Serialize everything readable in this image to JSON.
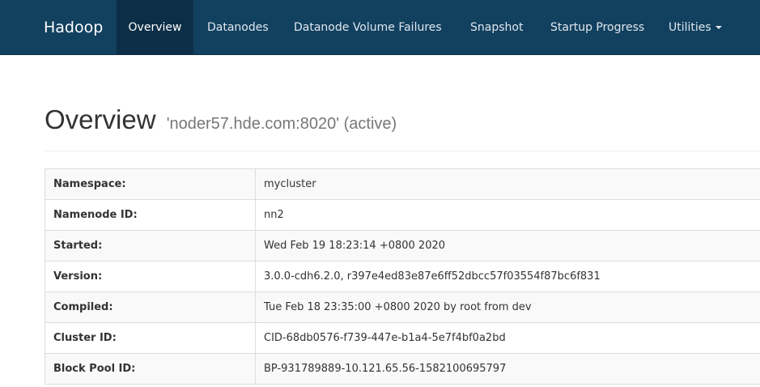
{
  "navbar": {
    "brand": "Hadoop",
    "items": [
      {
        "label": "Overview"
      },
      {
        "label": "Datanodes"
      },
      {
        "label": "Datanode Volume Failures"
      },
      {
        "label": "Snapshot"
      },
      {
        "label": "Startup Progress"
      },
      {
        "label": "Utilities"
      }
    ]
  },
  "header": {
    "title": "Overview",
    "subtitle": "'noder57.hde.com:8020' (active)"
  },
  "summary": {
    "rows": [
      {
        "key": "Namespace:",
        "value": "mycluster"
      },
      {
        "key": "Namenode ID:",
        "value": "nn2"
      },
      {
        "key": "Started:",
        "value": "Wed Feb 19 18:23:14 +0800 2020"
      },
      {
        "key": "Version:",
        "value": "3.0.0-cdh6.2.0, r397e4ed83e87e6ff52dbcc57f03554f87bc6f831"
      },
      {
        "key": "Compiled:",
        "value": "Tue Feb 18 23:35:00 +0800 2020 by root from dev"
      },
      {
        "key": "Cluster ID:",
        "value": "CID-68db0576-f739-447e-b1a4-5e7f4bf0a2bd"
      },
      {
        "key": "Block Pool ID:",
        "value": "BP-931789889-10.121.65.56-1582100695797"
      }
    ]
  },
  "colors": {
    "navbar_bg": "#12405f",
    "navbar_active_bg": "#0c2f47",
    "stripe": "#f9f9f9",
    "border": "#dddddd"
  }
}
